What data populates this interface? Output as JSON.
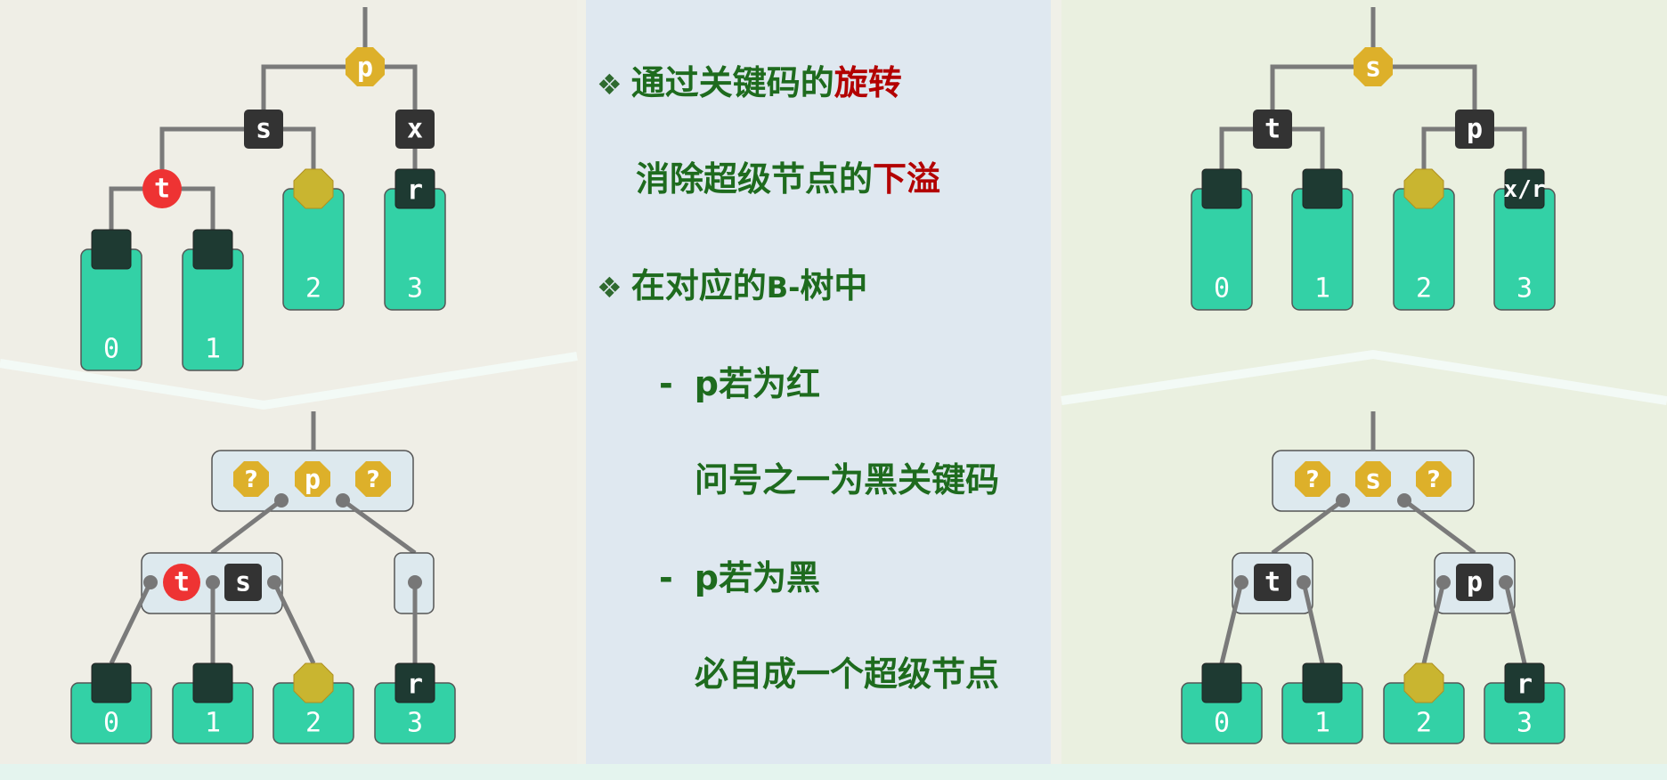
{
  "left_diagram": {
    "top": {
      "root": "p",
      "x": "x",
      "s": "s",
      "t": "t",
      "r": "r",
      "subtrees": [
        "0",
        "1",
        "2",
        "3"
      ]
    },
    "bottom": {
      "super_top": [
        "?",
        "p",
        "?"
      ],
      "super_left": [
        "t",
        "s"
      ],
      "r": "r",
      "subtrees": [
        "0",
        "1",
        "2",
        "3"
      ]
    }
  },
  "right_diagram": {
    "top": {
      "root": "s",
      "t": "t",
      "p": "p",
      "xr": "x/r",
      "subtrees": [
        "0",
        "1",
        "2",
        "3"
      ]
    },
    "bottom": {
      "super_top": [
        "?",
        "s",
        "?"
      ],
      "t": "t",
      "p": "p",
      "r": "r",
      "subtrees": [
        "0",
        "1",
        "2",
        "3"
      ]
    }
  },
  "text": {
    "bullet1_a": "通过关键码的",
    "bullet1_b": "旋转",
    "line2_a": "消除超级节点的",
    "line2_b": "下溢",
    "bullet2_a": "在对应的",
    "bullet2_b": "B-",
    "bullet2_c": "树中",
    "dash1": "-",
    "sub1": "p若为红",
    "sub1_detail": "问号之一为黑关键码",
    "dash2": "-",
    "sub2": "p若为黑",
    "sub2_detail": "必自成一个超级节点",
    "bullet_glyph": "❖"
  },
  "colors": {
    "red_node": "#ee3333",
    "black_node": "#333333",
    "gold_node": "#ddb02a",
    "subtree": "#33d1a6",
    "super_node": "#dde9ee",
    "text_green": "#1e6b1e",
    "text_red": "#b30000"
  }
}
